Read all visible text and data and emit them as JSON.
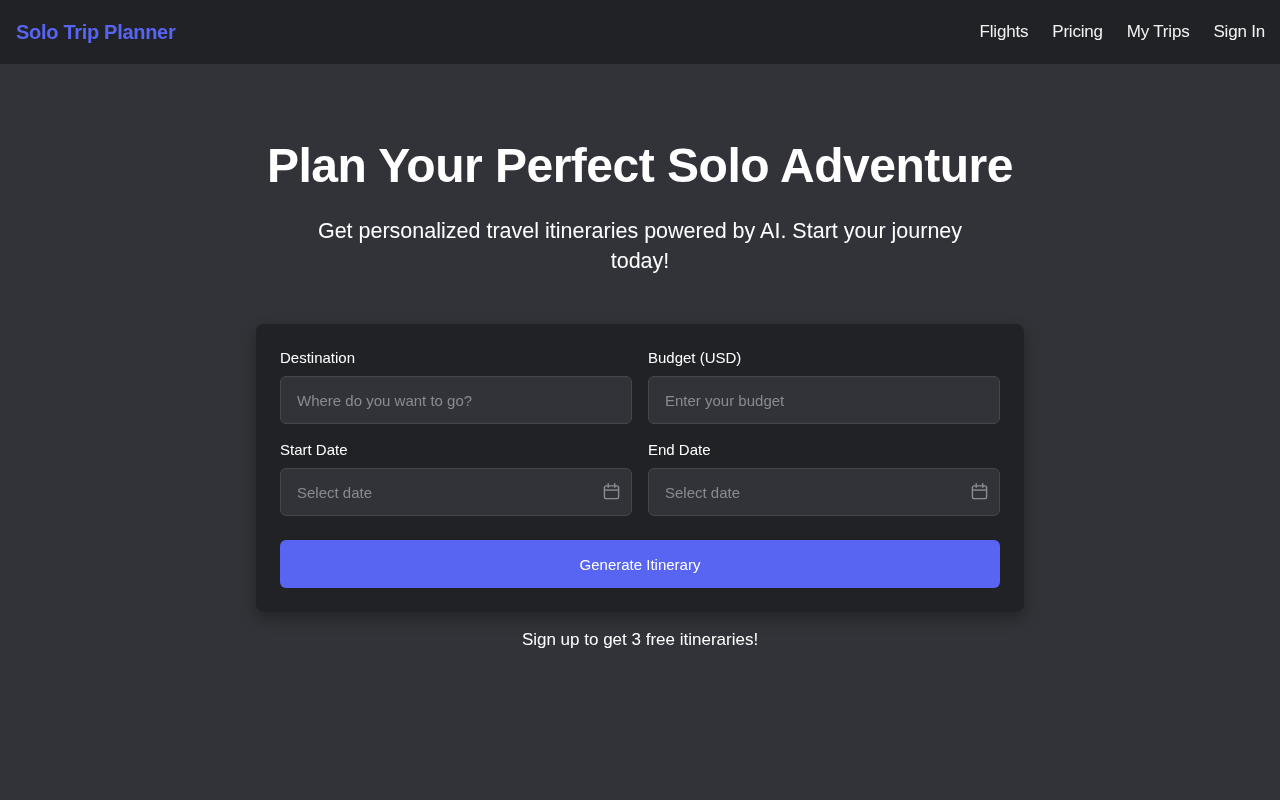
{
  "header": {
    "logo": "Solo Trip Planner",
    "nav_links": [
      "Flights",
      "Pricing",
      "My Trips",
      "Sign In"
    ]
  },
  "hero": {
    "title": "Plan Your Perfect Solo Adventure",
    "subtitle": "Get personalized travel itineraries powered by AI. Start your journey today!"
  },
  "form": {
    "fields": [
      {
        "label": "Destination",
        "kind": "text",
        "placeholder": "Where do you want to go?"
      },
      {
        "label": "Budget (USD)",
        "kind": "text",
        "placeholder": "Enter your budget"
      },
      {
        "label": "Start Date",
        "kind": "date",
        "placeholder": "Select date"
      },
      {
        "label": "End Date",
        "kind": "date",
        "placeholder": "Select date"
      }
    ],
    "submit_button": "Generate Itinerary"
  },
  "footer_note": "Sign up to get 3 free itineraries!"
}
